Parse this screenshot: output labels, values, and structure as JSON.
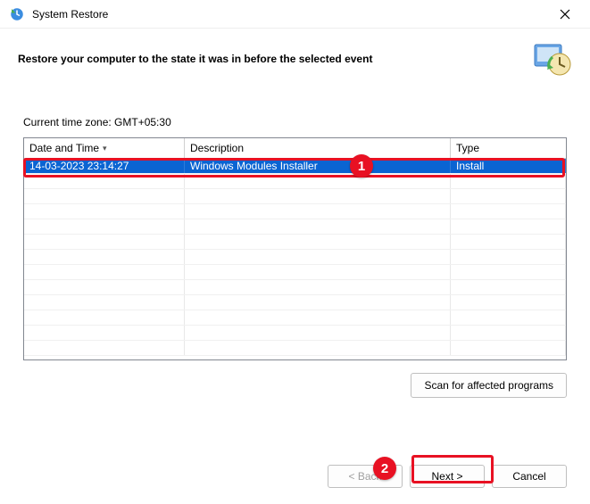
{
  "window": {
    "title": "System Restore",
    "header": "Restore your computer to the state it was in before the selected event"
  },
  "timezone_label": "Current time zone: GMT+05:30",
  "columns": {
    "date": "Date and Time",
    "desc": "Description",
    "type": "Type"
  },
  "rows": [
    {
      "date": "14-03-2023 23:14:27",
      "desc": "Windows Modules Installer",
      "type": "Install"
    }
  ],
  "buttons": {
    "scan": "Scan for affected programs",
    "back": "< Back",
    "next": "Next >",
    "cancel": "Cancel"
  },
  "markers": {
    "one": "1",
    "two": "2"
  }
}
